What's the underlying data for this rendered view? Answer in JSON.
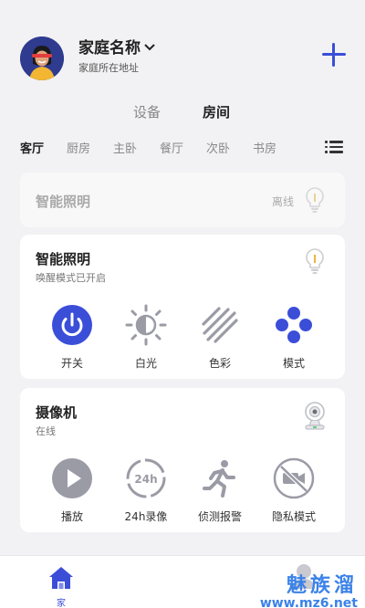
{
  "header": {
    "home_name": "家庭名称",
    "home_address": "家庭所在地址"
  },
  "segments": [
    {
      "label": "设备",
      "active": false
    },
    {
      "label": "房间",
      "active": true
    }
  ],
  "rooms": [
    {
      "label": "客厅",
      "active": true
    },
    {
      "label": "厨房",
      "active": false
    },
    {
      "label": "主卧",
      "active": false
    },
    {
      "label": "餐厅",
      "active": false
    },
    {
      "label": "次卧",
      "active": false
    },
    {
      "label": "书房",
      "active": false
    }
  ],
  "devices": {
    "offline_light": {
      "title": "智能照明",
      "status": "离线"
    },
    "light": {
      "title": "智能照明",
      "subtitle": "唤醒模式已开启",
      "controls": [
        {
          "label": "开关",
          "icon": "power-icon"
        },
        {
          "label": "白光",
          "icon": "sun-icon"
        },
        {
          "label": "色彩",
          "icon": "stripes-icon"
        },
        {
          "label": "模式",
          "icon": "mode-icon"
        }
      ]
    },
    "camera": {
      "title": "摄像机",
      "subtitle": "在线",
      "controls": [
        {
          "label": "播放",
          "icon": "play-icon"
        },
        {
          "label": "24h录像",
          "icon": "24h-icon"
        },
        {
          "label": "侦测报警",
          "icon": "running-icon"
        },
        {
          "label": "隐私模式",
          "icon": "privacy-icon"
        }
      ]
    }
  },
  "bottom_nav": {
    "home_label": "家"
  },
  "watermark": {
    "line1": "魅族溜",
    "line2": "www.mz6.net"
  },
  "colors": {
    "accent": "#3b4ed8",
    "background": "#f2f2f4",
    "icon_gray": "#9b9ba6"
  }
}
